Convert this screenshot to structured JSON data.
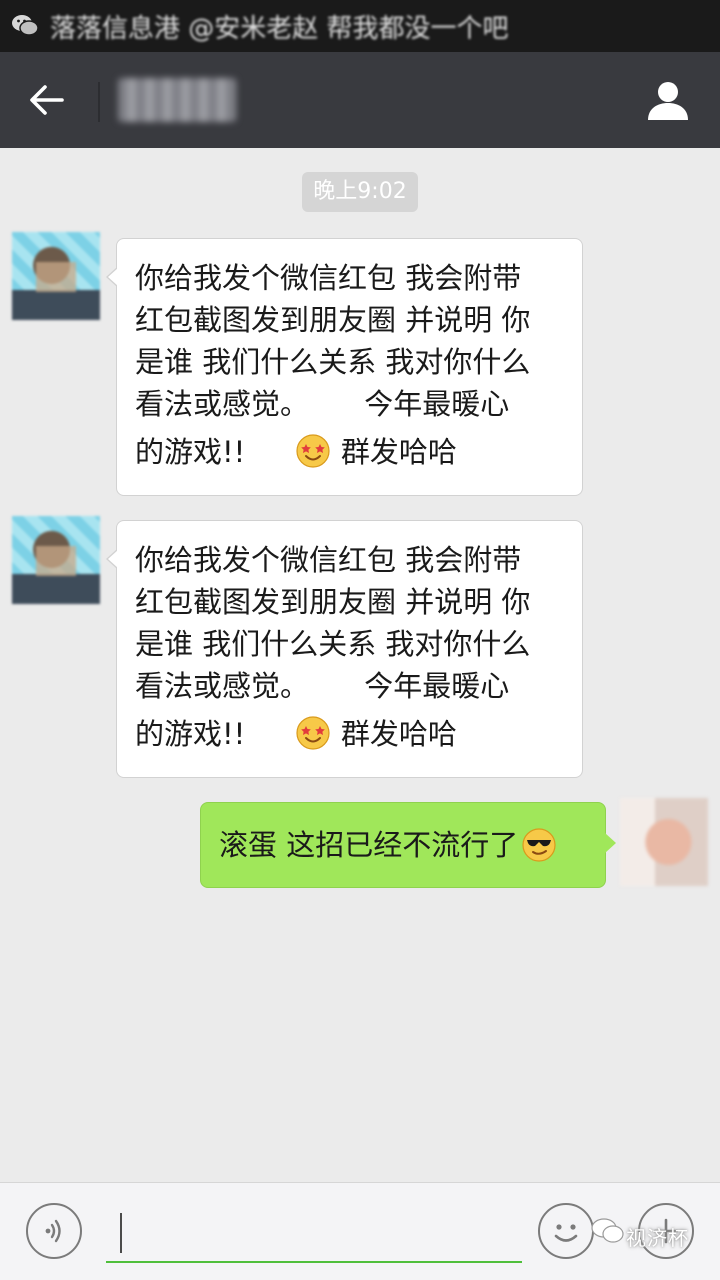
{
  "status_bar": {
    "notification_text": "落落信息港 @安米老赵 帮我都没一个吧",
    "app_icon": "wechat-icon"
  },
  "header": {
    "back_icon": "arrow-left-icon",
    "profile_icon": "person-icon",
    "background": "#393a3f"
  },
  "chat": {
    "timestamp": "晚上9:02",
    "messages": [
      {
        "sender": "friend",
        "lines": [
          "你给我发个微信红包 我会附带",
          "红包截图发到朋友圈 并说明 你",
          "是谁 我们什么关系 我对你什么",
          "看法或感觉。      今年最暖心"
        ],
        "last_line_before": "的游戏!!",
        "last_line_emoji": "star-eyes-emoji-icon",
        "last_line_after": "群发哈哈"
      },
      {
        "sender": "friend",
        "lines": [
          "你给我发个微信红包 我会附带",
          "红包截图发到朋友圈 并说明 你",
          "是谁 我们什么关系 我对你什么",
          "看法或感觉。      今年最暖心"
        ],
        "last_line_before": "的游戏!!",
        "last_line_emoji": "star-eyes-emoji-icon",
        "last_line_after": "群发哈哈"
      },
      {
        "sender": "me",
        "text": "滚蛋 这招已经不流行了",
        "emoji": "sunglasses-emoji-icon"
      }
    ],
    "incoming_bubble_color": "#ffffff",
    "outgoing_bubble_color": "#a0e75a"
  },
  "input_bar": {
    "voice_icon": "voice-icon",
    "emoji_icon": "emoji-icon",
    "plus_icon": "plus-icon",
    "accent": "#4fbf3b",
    "text": ""
  },
  "watermark": {
    "text": "视济杯"
  }
}
